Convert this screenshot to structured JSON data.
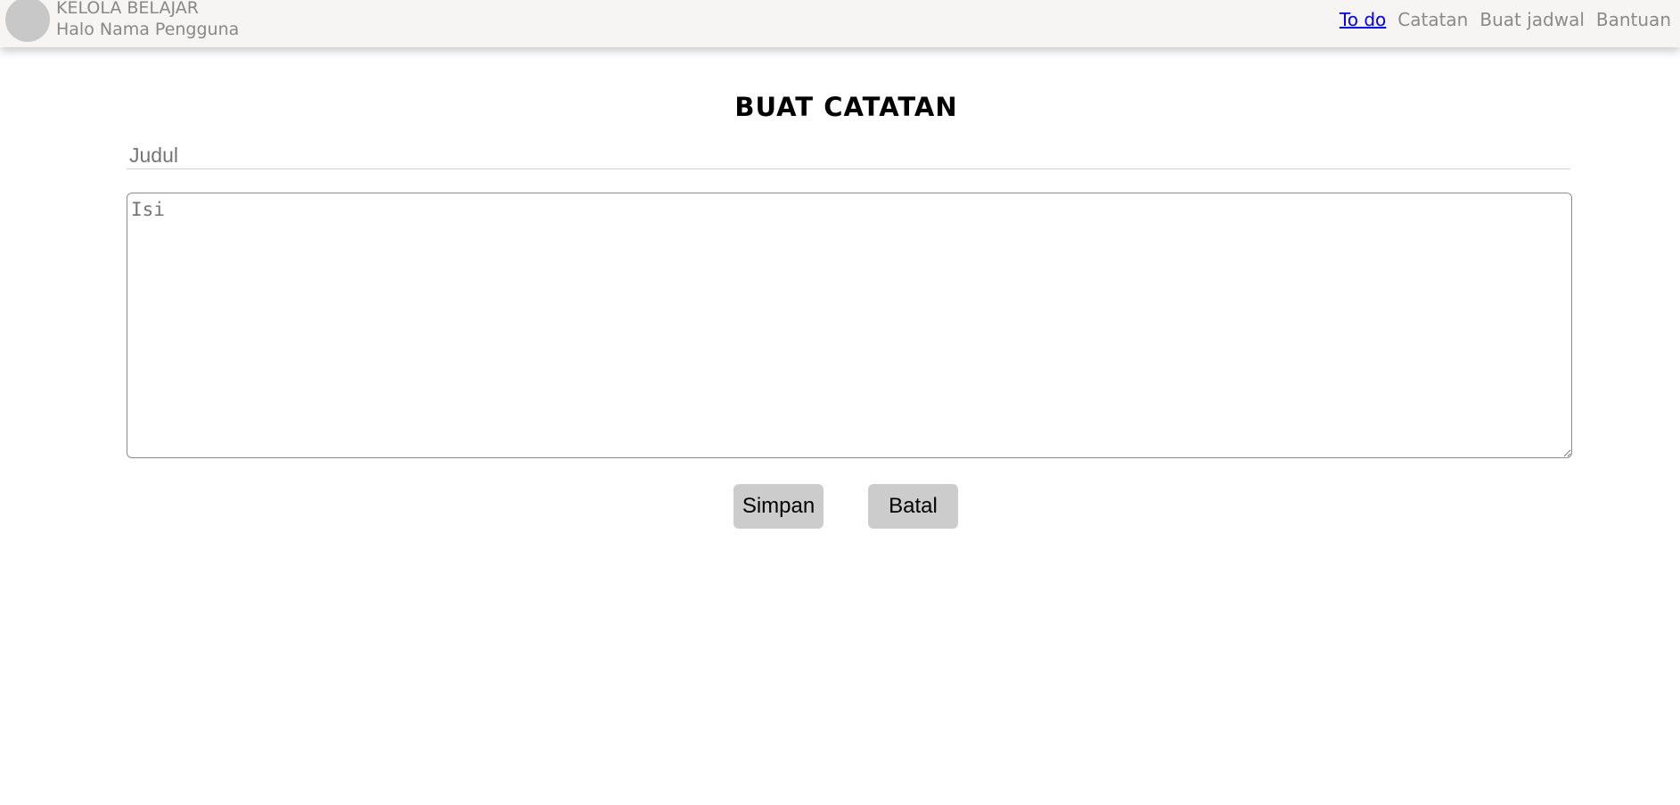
{
  "header": {
    "app_title": "KELOLA BELAJAR",
    "greeting": "Halo Nama Pengguna",
    "nav": [
      {
        "label": "To do",
        "active": true
      },
      {
        "label": "Catatan",
        "active": false
      },
      {
        "label": "Buat jadwal",
        "active": false
      },
      {
        "label": "Bantuan",
        "active": false
      }
    ]
  },
  "main": {
    "title": "BUAT CATATAN",
    "judul_placeholder": "Judul",
    "judul_value": "",
    "isi_placeholder": "Isi",
    "isi_value": "",
    "save_label": "Simpan",
    "cancel_label": "Batal"
  },
  "colors": {
    "header_bg": "#f6f5f3",
    "button_bg": "#cccccc",
    "active_link": "#0000ee",
    "muted_text": "#888888"
  }
}
